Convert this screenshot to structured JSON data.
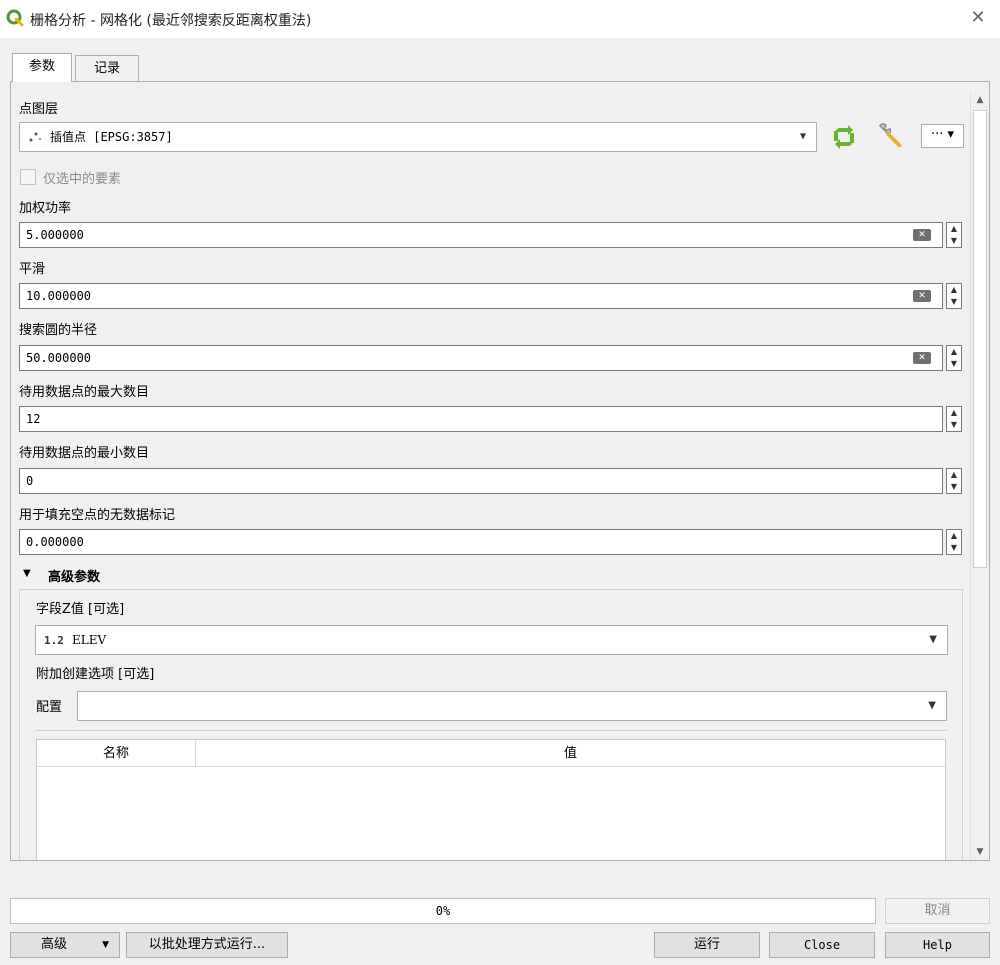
{
  "window": {
    "title": "栅格分析 - 网格化 (最近邻搜索反距离权重法)",
    "close_glyph": "✕"
  },
  "tabs": [
    {
      "label": "参数",
      "active": true
    },
    {
      "label": "记录",
      "active": false
    }
  ],
  "params": {
    "point_layer": {
      "label": "点图层",
      "value": "插值点 [EPSG:3857]",
      "selected_only_label": "仅选中的要素"
    },
    "weight_power": {
      "label": "加权功率",
      "value": "5.000000"
    },
    "smoothing": {
      "label": "平滑",
      "value": "10.000000"
    },
    "radius": {
      "label": "搜索圆的半径",
      "value": "50.000000"
    },
    "max_points": {
      "label": "待用数据点的最大数目",
      "value": "12"
    },
    "min_points": {
      "label": "待用数据点的最小数目",
      "value": "0"
    },
    "nodata": {
      "label": "用于填充空点的无数据标记",
      "value": "0.000000"
    }
  },
  "advanced": {
    "header": "高级参数",
    "z_field": {
      "label": "字段Z值 [可选]",
      "type_badge": "1.2",
      "value": "ELEV"
    },
    "creation_options": {
      "label": "附加创建选项 [可选]"
    },
    "profile": {
      "label": "配置",
      "value": ""
    },
    "table": {
      "columns": [
        "名称",
        "值"
      ]
    }
  },
  "footer": {
    "progress_text": "0%",
    "progress_value": 0,
    "cancel_label": "取消",
    "advanced_label": "高级",
    "batch_label": "以批处理方式运行...",
    "run_label": "运行",
    "close_label": "Close",
    "help_label": "Help"
  },
  "colors": {
    "qgis_green": "#589632",
    "refresh_green": "#6ab42d",
    "wrench": "#e0b030"
  },
  "icons": {
    "app": "qgis-logo-icon",
    "layer": "point-layer-icon",
    "refresh": "refresh-icon",
    "wrench": "wrench-icon",
    "more": "ellipsis-icon"
  }
}
